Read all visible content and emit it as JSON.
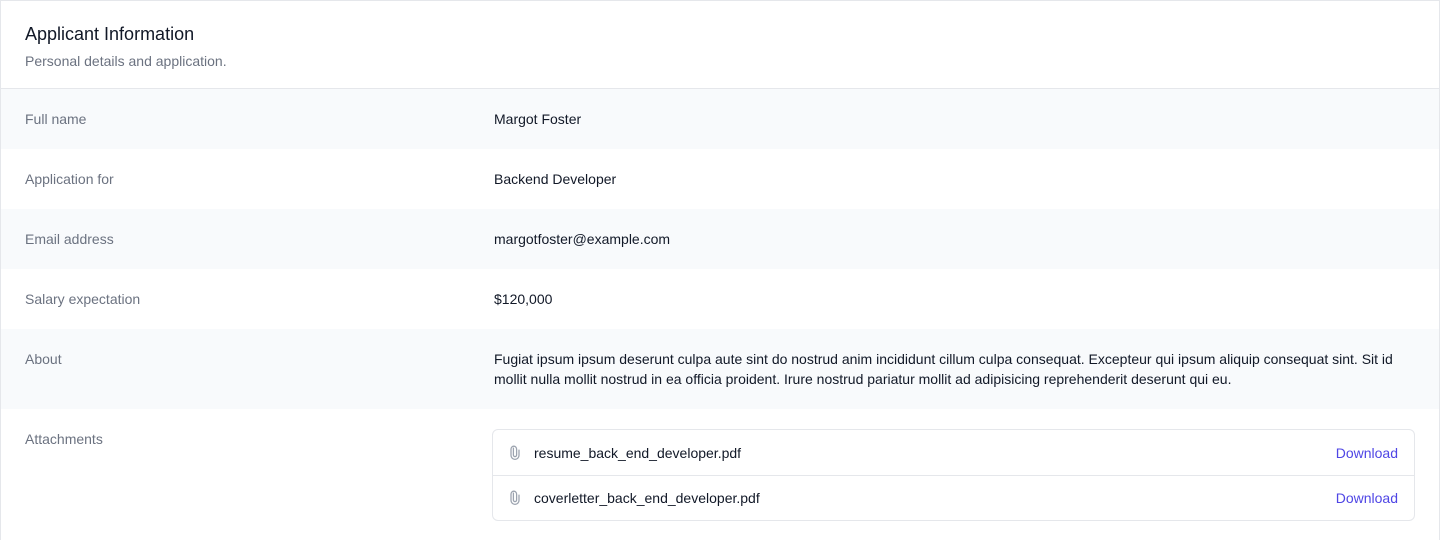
{
  "header": {
    "title": "Applicant Information",
    "subtitle": "Personal details and application."
  },
  "fields": {
    "full_name": {
      "label": "Full name",
      "value": "Margot Foster"
    },
    "application_for": {
      "label": "Application for",
      "value": "Backend Developer"
    },
    "email": {
      "label": "Email address",
      "value": "margotfoster@example.com"
    },
    "salary": {
      "label": "Salary expectation",
      "value": "$120,000"
    },
    "about": {
      "label": "About",
      "value": "Fugiat ipsum ipsum deserunt culpa aute sint do nostrud anim incididunt cillum culpa consequat. Excepteur qui ipsum aliquip consequat sint. Sit id mollit nulla mollit nostrud in ea officia proident. Irure nostrud pariatur mollit ad adipisicing reprehenderit deserunt qui eu."
    },
    "attachments": {
      "label": "Attachments",
      "items": [
        {
          "filename": "resume_back_end_developer.pdf",
          "action": "Download",
          "icon": "paperclip-icon"
        },
        {
          "filename": "coverletter_back_end_developer.pdf",
          "action": "Download",
          "icon": "paperclip-icon"
        }
      ]
    }
  },
  "colors": {
    "accent": "#4f46e5",
    "muted_text": "#6b7280",
    "row_shade": "#f8fafc",
    "border": "#e5e7eb"
  }
}
